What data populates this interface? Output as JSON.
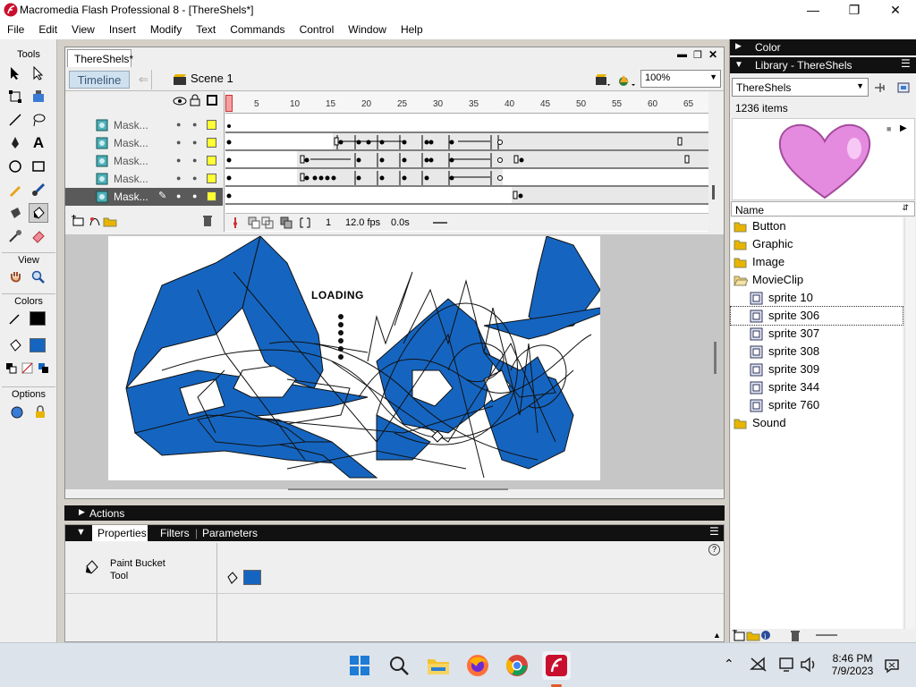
{
  "window": {
    "title": "Macromedia Flash Professional 8 - [ThereShels*]"
  },
  "menu": [
    "File",
    "Edit",
    "View",
    "Insert",
    "Modify",
    "Text",
    "Commands",
    "Control",
    "Window",
    "Help"
  ],
  "tools": {
    "title": "Tools",
    "view_label": "View",
    "colors_label": "Colors",
    "options_label": "Options",
    "stroke_color": "#000000",
    "fill_color": "#1565c0"
  },
  "document": {
    "tab": "ThereShels*",
    "timeline_button": "Timeline",
    "scene": "Scene 1",
    "zoom": "100%",
    "ruler_ticks": [
      "1",
      "5",
      "10",
      "15",
      "20",
      "25",
      "30",
      "35",
      "40",
      "45",
      "50",
      "55",
      "60",
      "65"
    ],
    "layers": [
      "Mask...",
      "Mask...",
      "Mask...",
      "Mask...",
      "Mask..."
    ],
    "status": {
      "frame": "1",
      "fps": "12.0 fps",
      "time": "0.0s"
    },
    "stage_text": "LOADING"
  },
  "actions": {
    "label": "Actions"
  },
  "properties": {
    "tabs": [
      "Properties",
      "Filters",
      "Parameters"
    ],
    "tool_name_line1": "Paint Bucket",
    "tool_name_line2": "Tool",
    "fill_color": "#1565c0"
  },
  "right": {
    "color_header": "Color",
    "library_header": "Library - ThereShels",
    "library_select": "ThereShels",
    "item_count": "1236 items",
    "name_column": "Name",
    "items": [
      {
        "label": "Button",
        "kind": "folder"
      },
      {
        "label": "Graphic",
        "kind": "folder"
      },
      {
        "label": "Image",
        "kind": "folder"
      },
      {
        "label": "MovieClip",
        "kind": "folder-open"
      },
      {
        "label": "sprite 10",
        "kind": "movieclip"
      },
      {
        "label": "sprite 306",
        "kind": "movieclip"
      },
      {
        "label": "sprite 307",
        "kind": "movieclip"
      },
      {
        "label": "sprite 308",
        "kind": "movieclip"
      },
      {
        "label": "sprite 309",
        "kind": "movieclip"
      },
      {
        "label": "sprite 344",
        "kind": "movieclip"
      },
      {
        "label": "sprite 760",
        "kind": "movieclip"
      },
      {
        "label": "Sound",
        "kind": "folder"
      }
    ]
  },
  "taskbar": {
    "time": "8:46 PM",
    "date": "7/9/2023"
  }
}
